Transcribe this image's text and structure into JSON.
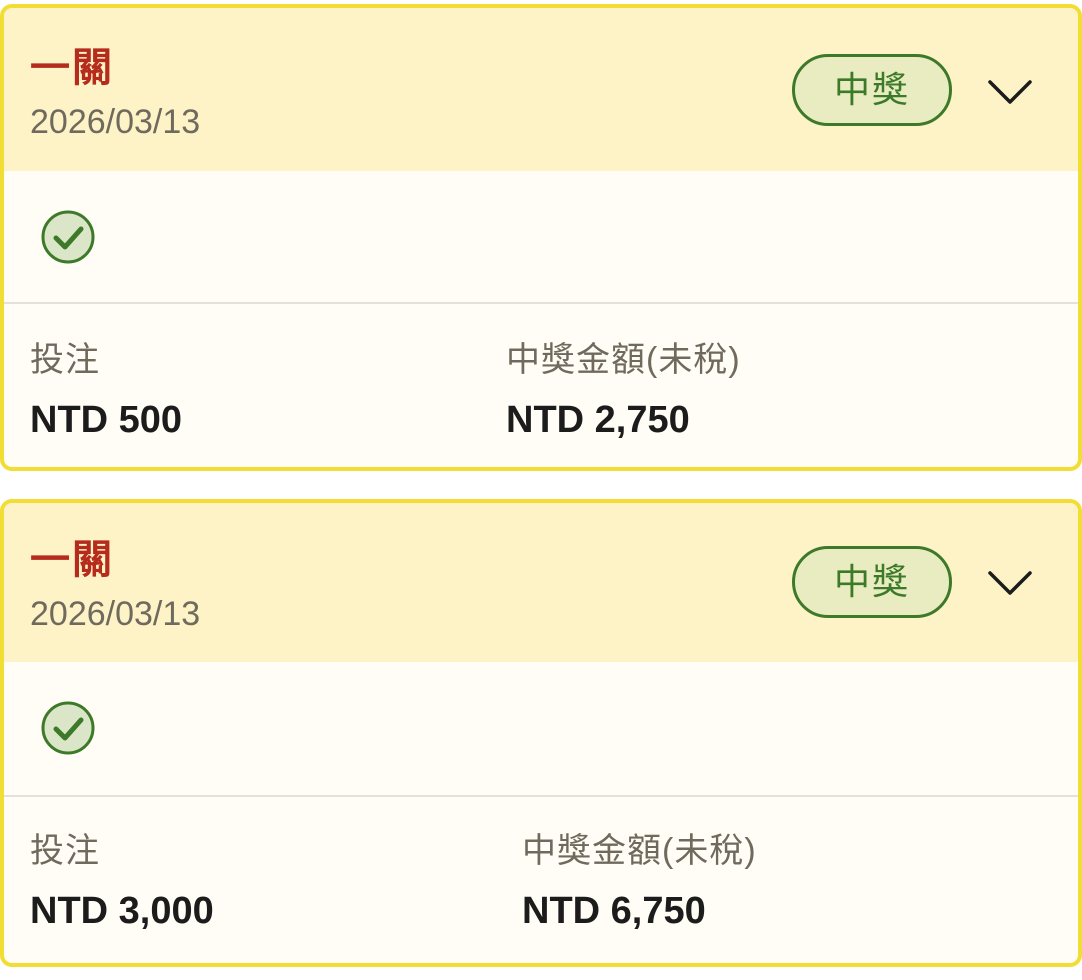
{
  "bets": [
    {
      "game_name": "一關",
      "date": "2026/03/13",
      "status": "中獎",
      "stake_label": "投注",
      "stake_value": "NTD 500",
      "payout_label": "中獎金額(未稅)",
      "payout_value": "NTD 2,750",
      "pick_icon": "check-circle-icon"
    },
    {
      "game_name": "一關",
      "date": "2026/03/13",
      "status": "中獎",
      "stake_label": "投注",
      "stake_value": "NTD 3,000",
      "payout_label": "中獎金額(未稅)",
      "payout_value": "NTD 6,750",
      "pick_icon": "check-circle-icon"
    }
  ],
  "colors": {
    "card_border": "#f2dd35",
    "header_bg": "#fdf3c6",
    "body_bg": "#fffdf5",
    "game_name": "#b52b1c",
    "win_green": "#3c7a29",
    "badge_bg": "#e9ecc0"
  }
}
